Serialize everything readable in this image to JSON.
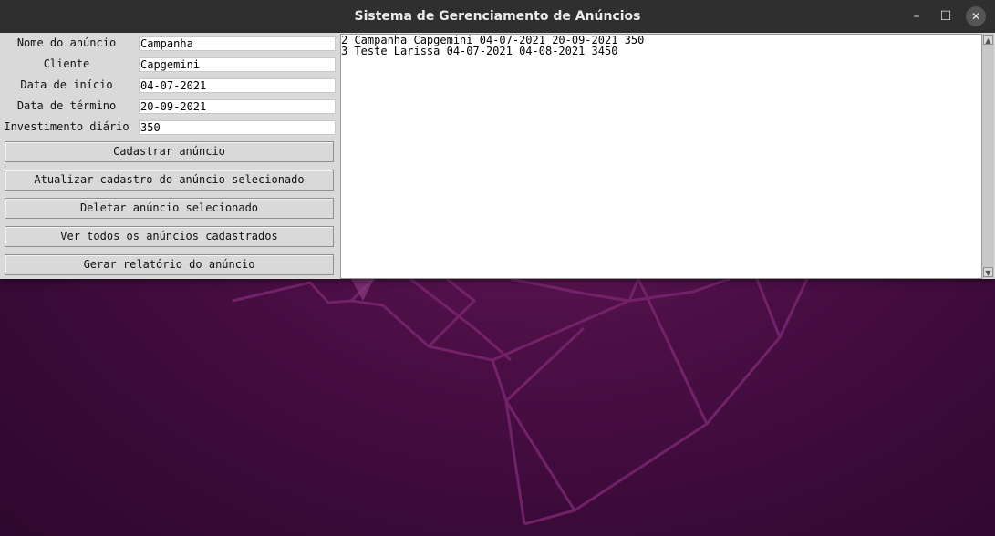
{
  "window": {
    "title": "Sistema de Gerenciamento de Anúncios",
    "controls": {
      "minimize": "–",
      "maximize": "☐",
      "close": "✕"
    }
  },
  "form": {
    "fields": [
      {
        "label": "Nome do anúncio",
        "value": "Campanha"
      },
      {
        "label": "Cliente",
        "value": "Capgemini"
      },
      {
        "label": "Data de início",
        "value": "04-07-2021"
      },
      {
        "label": "Data de término",
        "value": "20-09-2021"
      },
      {
        "label": "Investimento diário",
        "value": "350"
      }
    ],
    "buttons": [
      "Cadastrar anúncio",
      "Atualizar cadastro do anúncio selecionado",
      "Deletar anúncio selecionado",
      "Ver todos os anúncios cadastrados",
      "Gerar relatório do anúncio"
    ]
  },
  "listbox": {
    "rows": [
      "2 Campanha Capgemini 04-07-2021 20-09-2021 350",
      "3 Teste Larissa 04-07-2021 04-08-2021 3450"
    ]
  },
  "scrollbar": {
    "up_arrow": "▲",
    "down_arrow": "▼"
  },
  "colors": {
    "titlebar": "#2f2f2f",
    "window_bg": "#d9d9d9",
    "wallpaper": "#4e0f47"
  }
}
